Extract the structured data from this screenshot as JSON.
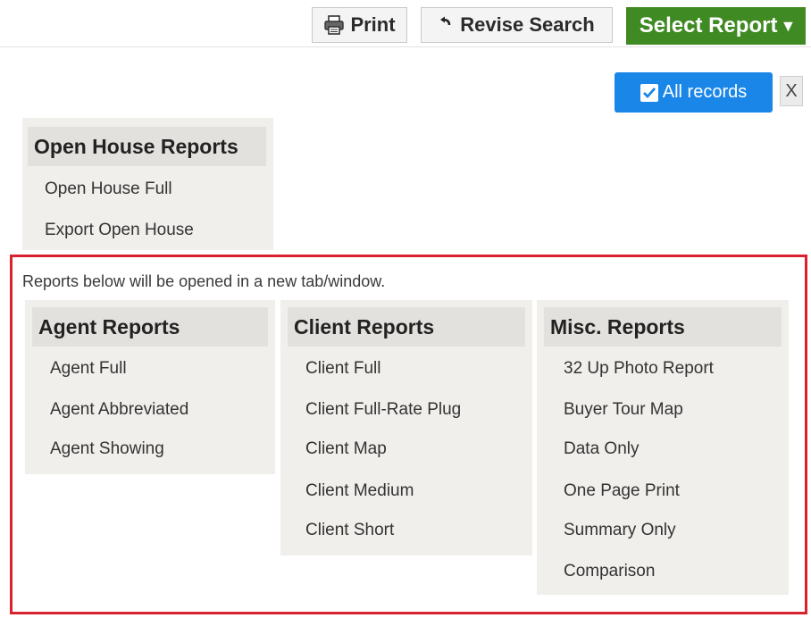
{
  "toolbar": {
    "print_label": "Print",
    "print_icon": "printer-icon",
    "revise_label": "Revise Search",
    "revise_icon": "back-arrow-icon",
    "select_report_label": "Select Report",
    "select_report_caret": "▼"
  },
  "filter": {
    "all_records_label": "All records",
    "close_label": "X"
  },
  "open_house": {
    "title": "Open House Reports",
    "items": [
      "Open House Full",
      "Export Open House"
    ]
  },
  "new_tab_note": "Reports below will be opened in a new tab/window.",
  "agent": {
    "title": "Agent Reports",
    "items": [
      "Agent Full",
      "Agent Abbreviated",
      "Agent Showing"
    ]
  },
  "client": {
    "title": "Client Reports",
    "items": [
      "Client Full",
      "Client Full-Rate Plug",
      "Client Map",
      "Client Medium",
      "Client Short"
    ]
  },
  "misc": {
    "title": "Misc. Reports",
    "items": [
      "32 Up Photo Report",
      "Buyer Tour Map",
      "Data Only",
      "One Page Print",
      "Summary Only",
      "Comparison"
    ]
  },
  "colors": {
    "select_report_bg": "#3f8a23",
    "all_records_bg": "#1a86e8",
    "highlight_border": "#d9222e",
    "group_bg": "#f1efec",
    "group_title_bg": "#e3e1dd"
  }
}
